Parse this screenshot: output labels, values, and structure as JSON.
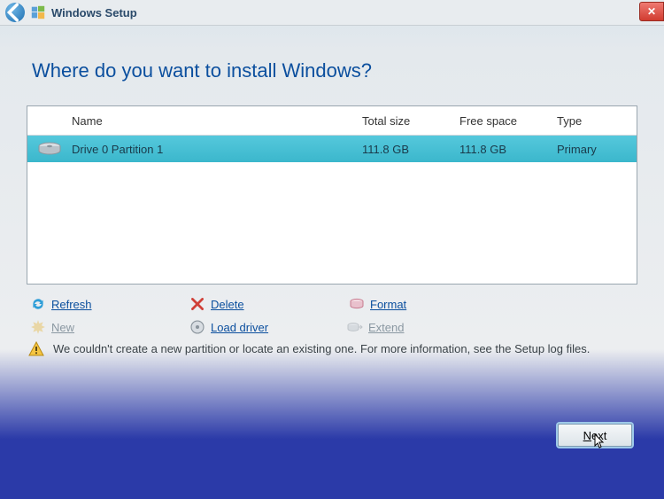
{
  "window": {
    "title": "Windows Setup"
  },
  "heading": "Where do you want to install Windows?",
  "columns": {
    "name": "Name",
    "total": "Total size",
    "free": "Free space",
    "type": "Type"
  },
  "partitions": [
    {
      "name": "Drive 0 Partition 1",
      "total": "111.8 GB",
      "free": "111.8 GB",
      "type": "Primary",
      "selected": true
    }
  ],
  "actions": {
    "refresh": "Refresh",
    "delete": "Delete",
    "format": "Format",
    "new": "New",
    "load_driver": "Load driver",
    "extend": "Extend"
  },
  "warning": "We couldn't create a new partition or locate an existing one. For more information, see the Setup log files.",
  "buttons": {
    "next": "Next"
  }
}
